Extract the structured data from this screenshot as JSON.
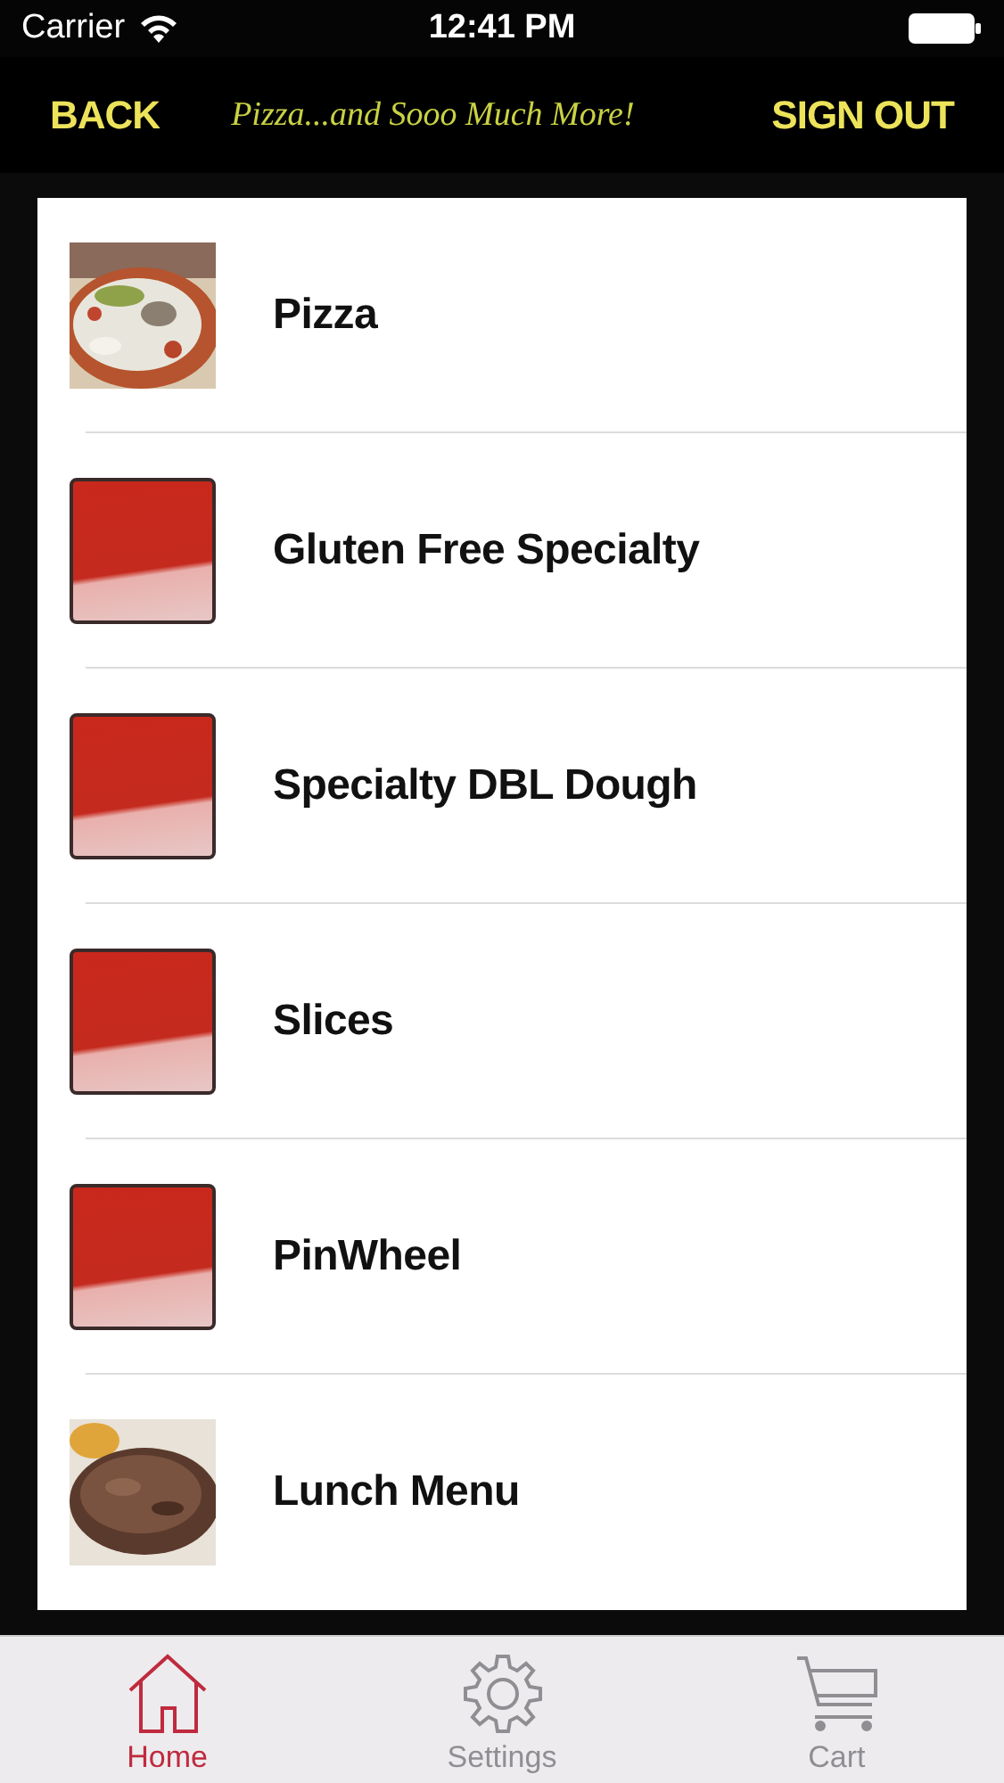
{
  "status_bar": {
    "carrier": "Carrier",
    "time": "12:41 PM"
  },
  "nav_bar": {
    "back": "BACK",
    "tagline": "Pizza...and Sooo Much More!",
    "sign_out": "SIGN OUT"
  },
  "menu": [
    {
      "label": "Pizza",
      "kind": "pizza"
    },
    {
      "label": "Gluten Free Specialty",
      "kind": "placeholder"
    },
    {
      "label": "Specialty DBL Dough",
      "kind": "placeholder"
    },
    {
      "label": "Slices",
      "kind": "placeholder"
    },
    {
      "label": "PinWheel",
      "kind": "placeholder"
    },
    {
      "label": "Lunch Menu",
      "kind": "steak"
    }
  ],
  "tab_bar": [
    {
      "label": "Home",
      "kind": "home",
      "selected": true
    },
    {
      "label": "Settings",
      "kind": "settings",
      "selected": false
    },
    {
      "label": "Cart",
      "kind": "cart",
      "selected": false
    }
  ]
}
